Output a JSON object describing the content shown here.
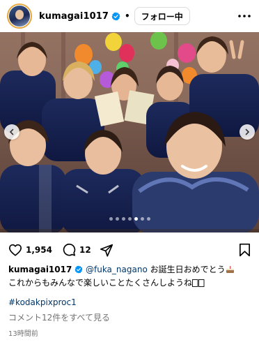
{
  "header": {
    "username": "kumagai1017",
    "separator": "•",
    "follow_label": "フォロー中"
  },
  "post": {
    "carousel_total": 7,
    "carousel_active": 5
  },
  "actions": {
    "like_count": "1,954",
    "comment_count": "12"
  },
  "caption": {
    "username": "kumagai1017",
    "mention": "@fuka_nagano",
    "line1": "お誕生日おめでとう",
    "line2": "これからもみんなで楽しいことたくさんしようね"
  },
  "hashtag": "#kodakpixproc1",
  "view_comments": "コメント12件をすべて見る",
  "timestamp": "13時間前",
  "colors": {
    "verified": "#0095f6",
    "link": "#00376b",
    "secondary": "#737373"
  }
}
